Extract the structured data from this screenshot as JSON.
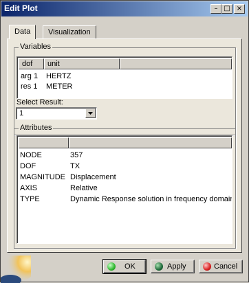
{
  "window": {
    "title": "Edit Plot"
  },
  "tabs": [
    {
      "label": "Data"
    },
    {
      "label": "Visualization"
    }
  ],
  "variables": {
    "group_label": "Variables",
    "columns": [
      "dof",
      "unit"
    ],
    "rows": [
      {
        "dof": "arg 1",
        "unit": "HERTZ"
      },
      {
        "dof": "res 1",
        "unit": "METER"
      }
    ]
  },
  "select_result": {
    "label": "Select Result:",
    "value": "1"
  },
  "attributes": {
    "group_label": "Attributes",
    "rows": [
      {
        "name": "NODE",
        "value": "357"
      },
      {
        "name": "DOF",
        "value": "TX"
      },
      {
        "name": "MAGNITUDE",
        "value": "Displacement"
      },
      {
        "name": "AXIS",
        "value": "Relative"
      },
      {
        "name": "TYPE",
        "value": "Dynamic Response solution in frequency domain"
      }
    ]
  },
  "buttons": {
    "ok": "OK",
    "apply": "Apply",
    "cancel": "Cancel"
  },
  "icons": {
    "minimize": "minimize-icon",
    "maximize": "maximize-icon",
    "close": "close-icon",
    "dropdown": "chevron-down-icon"
  },
  "colors": {
    "title_bar": "#0a246a",
    "ok_ball": "#2fb82f",
    "apply_ball": "#1f6a3a",
    "cancel_ball": "#d92020"
  }
}
